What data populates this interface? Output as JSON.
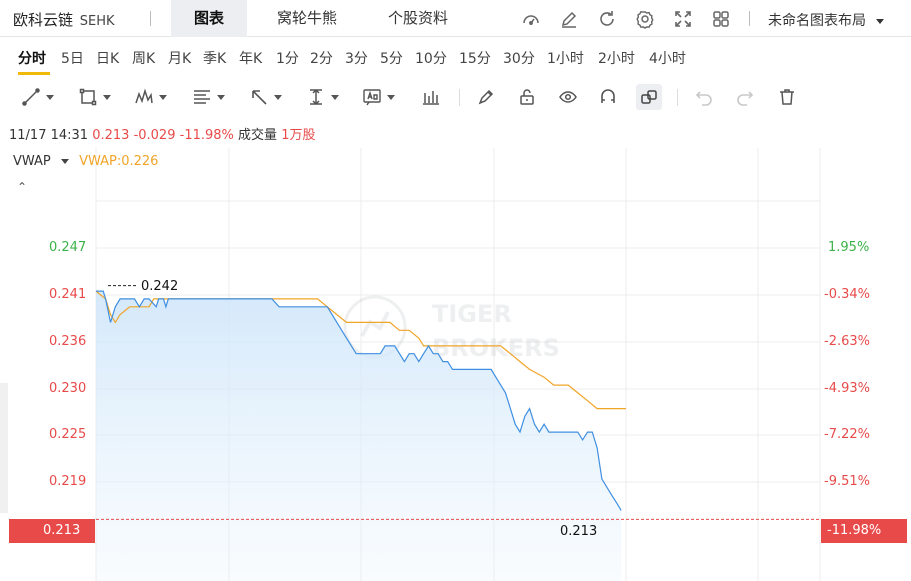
{
  "header": {
    "stock_name": "欧科云链",
    "stock_code": "SEHK",
    "tabs": [
      {
        "label": "图表",
        "active": true
      },
      {
        "label": "窝轮牛熊",
        "active": false
      },
      {
        "label": "个股资料",
        "active": false
      }
    ],
    "icons": [
      "gauge-icon",
      "pen-edit-icon",
      "refresh-icon",
      "gear-icon",
      "fullscreen-icon",
      "grid-layout-icon"
    ],
    "layout_name": "未命名图表布局"
  },
  "periods": [
    "分时",
    "5日",
    "日K",
    "周K",
    "月K",
    "季K",
    "年K",
    "1分",
    "2分",
    "3分",
    "5分",
    "10分",
    "15分",
    "30分",
    "1小时",
    "2小时",
    "4小时"
  ],
  "active_period": "分时",
  "toolbar_icons": [
    "trend-line-icon",
    "rectangle-icon",
    "wave-pattern-icon",
    "fibonacci-icon",
    "arrow-icon",
    "measure-icon",
    "text-annotation-icon",
    "bar-indicator-icon",
    "brush-icon",
    "unlock-icon",
    "eye-icon",
    "magnet-icon",
    "link-icon",
    "undo-icon",
    "redo-icon",
    "trash-icon"
  ],
  "info": {
    "datetime": "11/17 14:31",
    "price": "0.213",
    "change": "-0.029",
    "change_pct": "-11.98%",
    "volume_label": "成交量",
    "volume": "1万股"
  },
  "indicator": {
    "name": "VWAP",
    "value_label": "VWAP:0.226"
  },
  "colors": {
    "up": "#3bb34a",
    "down": "#e84a4a",
    "price_line": "#3f8fe0",
    "vwap_line": "#f0a428",
    "accent": "#f0b90b"
  },
  "chart_data": {
    "type": "line",
    "y_left_ticks": [
      "0.247",
      "0.241",
      "0.236",
      "0.230",
      "0.225",
      "0.219"
    ],
    "y_right_ticks": [
      "1.95%",
      "-0.34%",
      "-2.63%",
      "-4.93%",
      "-7.22%",
      "-9.51%"
    ],
    "ylim": [
      0.208,
      0.252
    ],
    "xlim": [
      0,
      220
    ],
    "prev_close": 0.242,
    "prev_close_label": "0.242",
    "last_price": 0.213,
    "last_price_label": "0.213",
    "last_pct_label": "-11.98%",
    "series": [
      {
        "key": "price",
        "x": [
          0,
          3,
          4,
          6,
          8,
          10,
          12,
          14,
          16,
          18,
          20,
          22,
          25,
          26,
          28,
          29,
          30,
          32,
          34,
          36,
          38,
          40,
          42,
          44,
          46,
          48,
          50,
          55,
          60,
          65,
          70,
          73,
          76,
          78,
          80,
          82,
          84,
          86,
          88,
          90,
          92,
          94,
          96,
          98,
          100,
          102,
          104,
          106,
          108,
          110,
          112,
          114,
          116,
          118,
          120,
          122,
          124,
          126,
          128,
          130,
          132,
          134,
          136,
          138,
          140,
          142,
          144,
          146,
          148,
          150,
          152,
          154,
          156,
          158,
          160,
          162,
          164,
          166,
          168,
          170,
          172,
          174,
          176,
          178,
          180,
          182,
          184,
          186,
          188,
          190,
          192,
          194,
          196,
          198,
          200,
          202,
          204,
          206,
          208,
          210,
          212,
          214,
          216,
          218
        ],
        "values": [
          0.2415,
          0.2415,
          0.2405,
          0.2375,
          0.2395,
          0.2405,
          0.2405,
          0.2405,
          0.2405,
          0.2395,
          0.2405,
          0.2405,
          0.2395,
          0.2405,
          0.2405,
          0.2395,
          0.2405,
          0.2405,
          0.2405,
          0.2405,
          0.2405,
          0.2405,
          0.2405,
          0.2405,
          0.2405,
          0.2405,
          0.2405,
          0.2405,
          0.2405,
          0.2405,
          0.2405,
          0.2405,
          0.2395,
          0.2395,
          0.2395,
          0.2395,
          0.2395,
          0.2395,
          0.2395,
          0.2395,
          0.2395,
          0.2395,
          0.2395,
          0.2385,
          0.2375,
          0.2365,
          0.2355,
          0.2345,
          0.2335,
          0.2335,
          0.2335,
          0.2335,
          0.2335,
          0.2335,
          0.2345,
          0.2345,
          0.2345,
          0.2335,
          0.2325,
          0.2335,
          0.2335,
          0.2325,
          0.2335,
          0.2345,
          0.2335,
          0.2335,
          0.2325,
          0.2325,
          0.2315,
          0.2315,
          0.2315,
          0.2315,
          0.2315,
          0.2315,
          0.2315,
          0.2315,
          0.2315,
          0.2305,
          0.2295,
          0.2285,
          0.2265,
          0.2245,
          0.2235,
          0.2255,
          0.2265,
          0.2245,
          0.2235,
          0.2245,
          0.2235,
          0.2235,
          0.2235,
          0.2235,
          0.2235,
          0.2235,
          0.2235,
          0.2225,
          0.2235,
          0.2235,
          0.2215,
          0.2175,
          0.2165,
          0.2155,
          0.2145,
          0.2135
        ]
      },
      {
        "key": "vwap",
        "x": [
          0,
          4,
          6,
          8,
          10,
          14,
          18,
          20,
          22,
          24,
          26,
          30,
          40,
          50,
          60,
          70,
          76,
          80,
          84,
          86,
          88,
          90,
          92,
          96,
          100,
          104,
          106,
          110,
          114,
          118,
          122,
          126,
          130,
          134,
          136,
          140,
          146,
          150,
          154,
          158,
          160,
          164,
          168,
          172,
          176,
          180,
          186,
          190,
          196,
          200,
          204,
          208,
          212,
          216,
          220
        ],
        "values": [
          0.2415,
          0.2405,
          0.2385,
          0.2375,
          0.2385,
          0.2395,
          0.2395,
          0.2395,
          0.2395,
          0.2405,
          0.2405,
          0.2405,
          0.2405,
          0.2405,
          0.2405,
          0.2405,
          0.2405,
          0.2405,
          0.2405,
          0.2405,
          0.2405,
          0.2405,
          0.2405,
          0.2395,
          0.2385,
          0.2375,
          0.2375,
          0.2375,
          0.2375,
          0.2375,
          0.2375,
          0.2365,
          0.2365,
          0.2355,
          0.2345,
          0.2345,
          0.2345,
          0.2345,
          0.2345,
          0.2345,
          0.2345,
          0.2345,
          0.2345,
          0.2335,
          0.2325,
          0.2315,
          0.2305,
          0.2295,
          0.2295,
          0.2285,
          0.2275,
          0.2265,
          0.2265,
          0.2265,
          0.2265
        ]
      }
    ]
  }
}
